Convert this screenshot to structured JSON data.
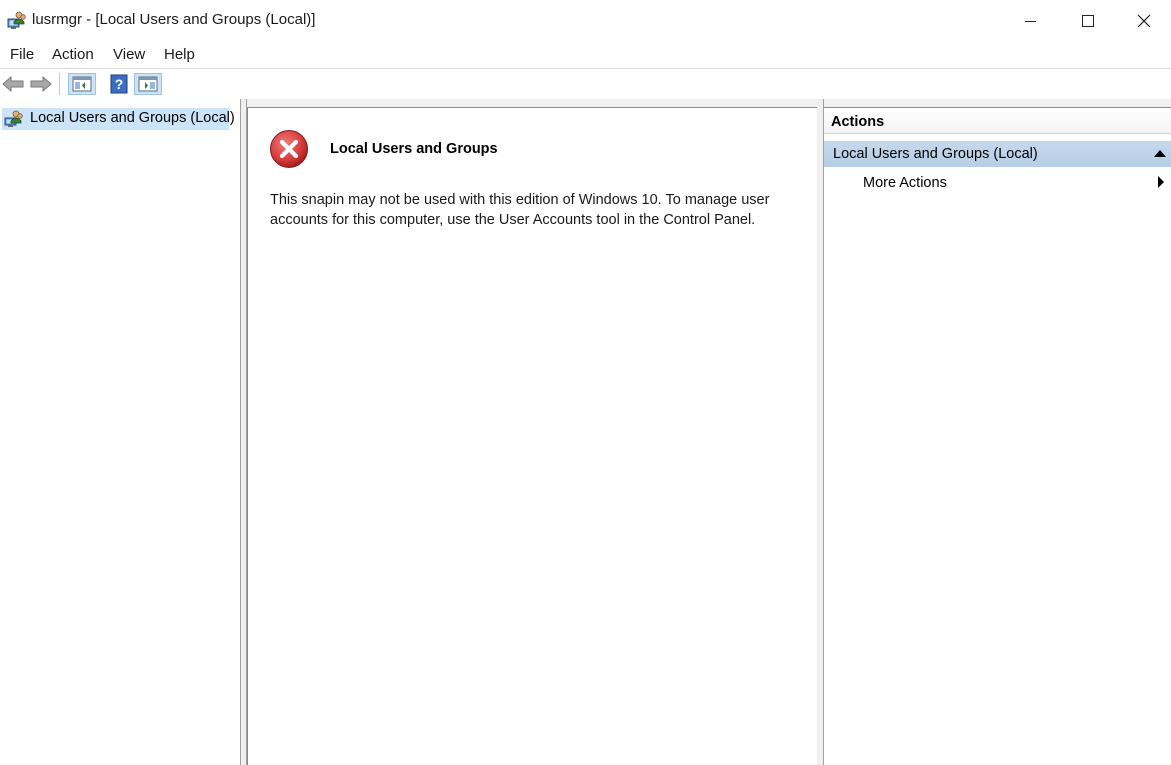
{
  "window": {
    "title": "lusrmgr - [Local Users and Groups (Local)]",
    "app_icon": "users-computer-icon",
    "controls": [
      "minimize-icon",
      "maximize-icon",
      "close-icon"
    ]
  },
  "menubar": {
    "items": [
      {
        "label": "File"
      },
      {
        "label": "Action"
      },
      {
        "label": "View"
      },
      {
        "label": "Help"
      }
    ]
  },
  "toolbar": {
    "buttons": [
      "back-arrow-icon",
      "forward-arrow-icon",
      "show-hide-console-tree-icon",
      "help-icon",
      "show-hide-action-pane-icon"
    ]
  },
  "tree": {
    "items": [
      {
        "label": "Local Users and Groups (Local)",
        "icon": "users-computer-icon",
        "selected": true
      }
    ]
  },
  "center": {
    "icon": "error-icon",
    "heading": "Local Users and Groups",
    "message": "This snapin may not be used with this edition of Windows 10. To manage user accounts for this computer, use the User Accounts tool in the Control Panel."
  },
  "actions": {
    "title": "Actions",
    "group_label": "Local Users and Groups (Local)",
    "items": [
      {
        "label": "More Actions"
      }
    ]
  },
  "colors": {
    "selection": "#cce4f7",
    "group_header": "#b6cde4",
    "error_red": "#d63b3b"
  }
}
